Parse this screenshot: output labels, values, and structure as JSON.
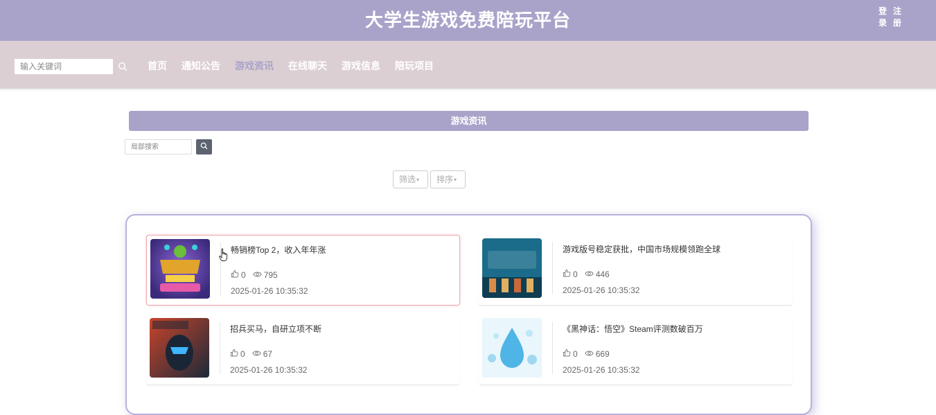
{
  "header": {
    "site_title": "大学生游戏免费陪玩平台",
    "login": "登录",
    "register": "注册"
  },
  "nav": {
    "search_placeholder": "输入关键词",
    "items": [
      {
        "label": "首页",
        "active": false
      },
      {
        "label": "通知公告",
        "active": false
      },
      {
        "label": "游戏资讯",
        "active": true
      },
      {
        "label": "在线聊天",
        "active": false
      },
      {
        "label": "游戏信息",
        "active": false
      },
      {
        "label": "陪玩项目",
        "active": false
      }
    ]
  },
  "main": {
    "section_title": "游戏资讯",
    "local_search_placeholder": "局部搜索",
    "filter_label": "筛选",
    "sort_label": "排序"
  },
  "news": [
    {
      "title": "畅销榜Top 2，收入年年涨",
      "likes": "0",
      "views": "795",
      "date": "2025-01-26 10:35:32",
      "image": "kingdom-rush-alliance"
    },
    {
      "title": "游戏版号稳定获批，中国市场规模领跑全球",
      "likes": "0",
      "views": "446",
      "date": "2025-01-26 10:35:32",
      "image": "the-escapists"
    },
    {
      "title": "招兵买马，自研立项不断",
      "likes": "0",
      "views": "67",
      "date": "2025-01-26 10:35:32",
      "image": "leap"
    },
    {
      "title": "《黑神话：悟空》Steam评测数破百万",
      "likes": "0",
      "views": "669",
      "date": "2025-01-26 10:35:32",
      "image": "water-drop"
    }
  ],
  "colors": {
    "primary": "#a9a3ca",
    "nav_bg": "#dccfd3",
    "hover_border": "#f0a8b0"
  }
}
